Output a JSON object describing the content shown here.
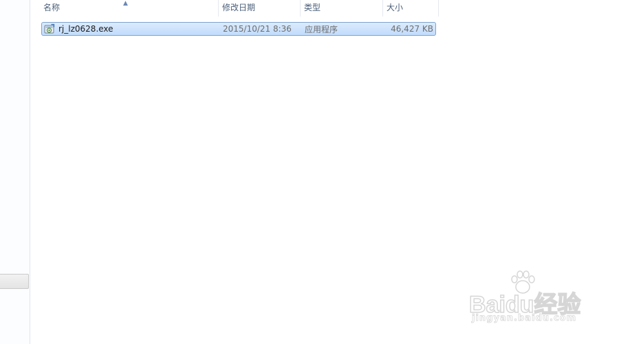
{
  "columns": {
    "name": "名称",
    "date": "修改日期",
    "type": "类型",
    "size": "大小"
  },
  "files": [
    {
      "name": "rj_lz0628.exe",
      "date": "2015/10/21 8:36",
      "type": "应用程序",
      "size": "46,427 KB",
      "icon": "exe-installer-icon",
      "selected": true
    }
  ],
  "watermark": {
    "logo_text": "Baidu经验",
    "url": "jingyan.baidu.com"
  },
  "colors": {
    "selection_fill": "#c9e0fc",
    "selection_border": "#7da2ce",
    "header_text": "#4c607a"
  }
}
